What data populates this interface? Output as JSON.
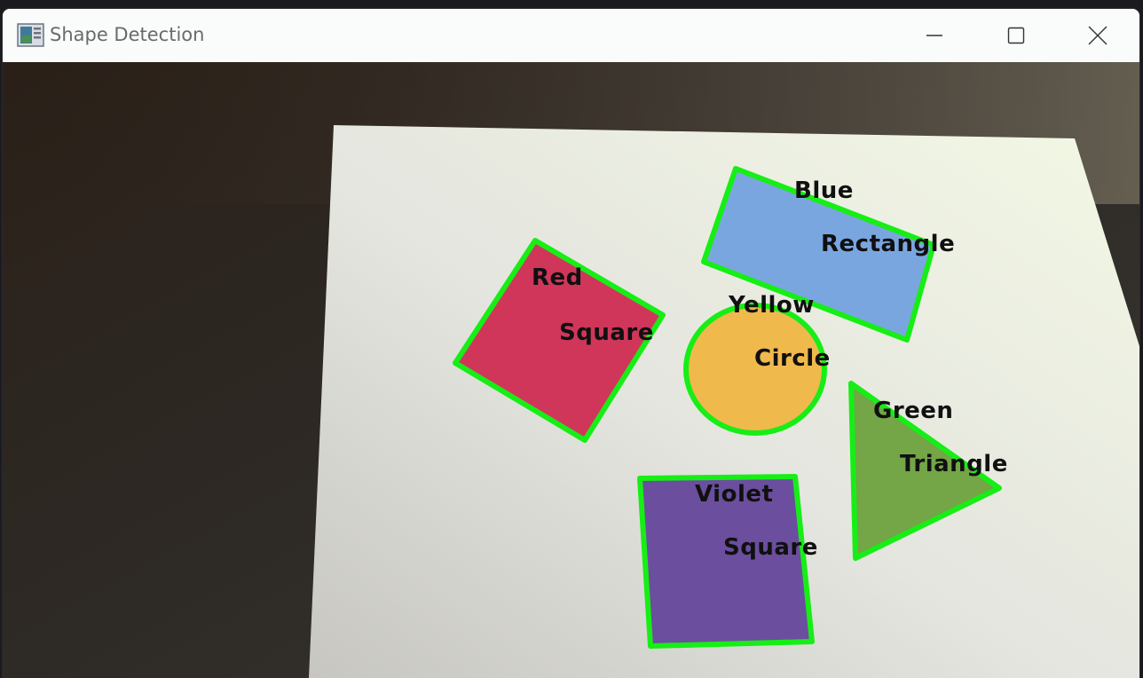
{
  "window": {
    "title": "Shape Detection",
    "app_icon": "image-viewer-icon",
    "controls": [
      "minimize-icon",
      "maximize-icon",
      "close-icon"
    ]
  },
  "detections": [
    {
      "color": "Blue",
      "shape": "Rectangle",
      "fill": "#7aa6e0"
    },
    {
      "color": "Red",
      "shape": "Square",
      "fill": "#d0365a"
    },
    {
      "color": "Yellow",
      "shape": "Circle",
      "fill": "#f0b94c"
    },
    {
      "color": "Green",
      "shape": "Triangle",
      "fill": "#74a547"
    },
    {
      "color": "Violet",
      "shape": "Square",
      "fill": "#6b4e9e"
    }
  ],
  "outline_color": "#16ee16"
}
